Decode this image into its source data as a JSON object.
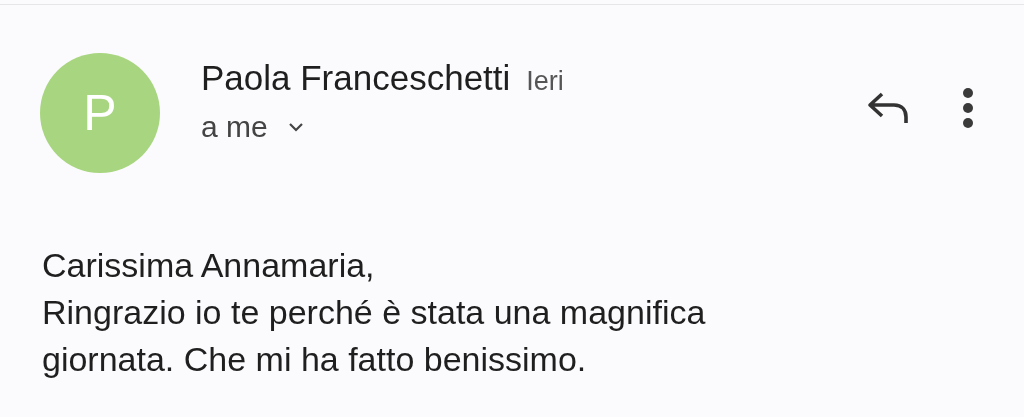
{
  "message": {
    "avatar_letter": "P",
    "color": "#a8d57f",
    "sender": "Paola Franceschetti",
    "date": "Ieri",
    "recipient": "a me"
  },
  "body": [
    "Carissima Annamaria,",
    "Ringrazio io te perché è stata una magnifica giornata. Che mi ha fatto benissimo."
  ]
}
